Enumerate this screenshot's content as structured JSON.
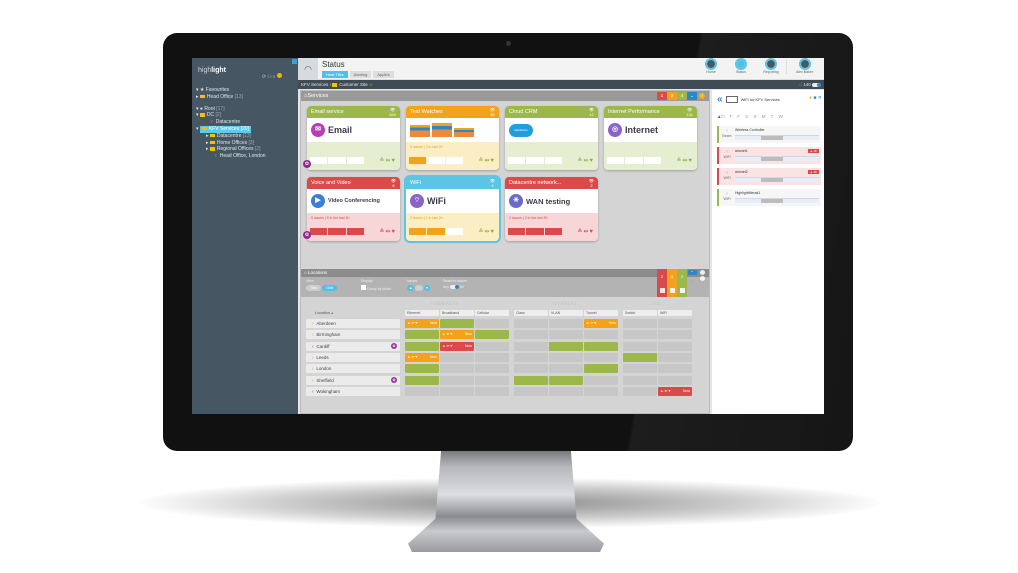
{
  "app": {
    "logo": "highlight",
    "logo_bold": "light",
    "logo_prefix": "high"
  },
  "sidebar": {
    "tree": [
      {
        "label": "Favourites",
        "count": ""
      },
      {
        "label": "Head Office",
        "count": "[13]"
      },
      {
        "label": "Root",
        "count": "[17]"
      },
      {
        "label": "DC",
        "count": "[2]"
      },
      {
        "label": "Datacentre",
        "count": ""
      },
      {
        "label": "KFV Services",
        "count": "[20]"
      },
      {
        "label": "Datacentre",
        "count": "[13]"
      },
      {
        "label": "Home Offices",
        "count": "[3]"
      },
      {
        "label": "Regional Offices",
        "count": "[2]"
      },
      {
        "label": "Head Office, London",
        "count": ""
      }
    ]
  },
  "topbar": {
    "title": "Status",
    "tabs": [
      "Heat Tiles",
      "Alerting",
      "Applt/s"
    ],
    "nav": [
      {
        "label": "Home"
      },
      {
        "label": "Status"
      },
      {
        "label": "Reporting"
      },
      {
        "label": "Alex Baker"
      }
    ]
  },
  "breadcrumb": {
    "root": "KFV Services",
    "sep": "›",
    "current": "Customer Site",
    "refresh": "140"
  },
  "services": {
    "title": "Services",
    "badges": [
      "1",
      "2",
      "4",
      "⌄",
      "?"
    ],
    "tiles": [
      {
        "header": "Email service",
        "count": "624",
        "name": "Email",
        "issues": "",
        "color": "g",
        "icon": "✉"
      },
      {
        "header": "Test Watches",
        "count": "30",
        "name": "",
        "issues": "3 issues | 2 in last 2h",
        "color": "o",
        "icon": ""
      },
      {
        "header": "Cloud CRM",
        "count": "12",
        "name": "salesforce",
        "issues": "",
        "color": "g",
        "icon": ""
      },
      {
        "header": "Internet Performance",
        "count": "131",
        "name": "Internet",
        "issues": "",
        "color": "g",
        "icon": "◎"
      },
      {
        "header": "Voice and Video",
        "count": "6",
        "name": "Video Conferencing",
        "issues": "5 issues | 5 in the last 2h",
        "color": "r",
        "icon": "▶"
      },
      {
        "header": "WiFi",
        "count": "4",
        "name": "WiFi",
        "issues": "2 issues | 1 in last 2h",
        "color": "c",
        "icon": "⌔"
      },
      {
        "header": "Datacentre network...",
        "count": "2",
        "name": "WAN testing",
        "issues": "2 issues | 2 in the last 2h",
        "color": "r",
        "icon": "✳"
      }
    ]
  },
  "locations": {
    "title": "Locations",
    "filters": {
      "view_label": "View",
      "view_tiles": "Tiles",
      "view_grid": "Grid",
      "display_label": "Display",
      "group_by": "Group by folder",
      "issues_label": "Issues",
      "react_label": "React to issues",
      "react_any": "Any",
      "react_all": "All"
    },
    "badge_counts": [
      "2",
      "3",
      "2"
    ],
    "groups": [
      "UNDERLAY",
      "OVERLAY",
      "LAN"
    ],
    "columns": [
      "Ethernet",
      "Broadband",
      "Cellular",
      "Class",
      "VLAN",
      "Tunnel",
      "Switch",
      "WiFi"
    ],
    "location_header": "Location",
    "rows": [
      {
        "name": "Aberdeen",
        "pin": "#f2a31b",
        "gear": false,
        "cells": [
          "O",
          "G",
          "",
          "",
          "",
          "O",
          "",
          ""
        ]
      },
      {
        "name": "Birmingham",
        "pin": "#f2a31b",
        "gear": false,
        "cells": [
          "G",
          "O",
          "G",
          "",
          "",
          "",
          "",
          ""
        ]
      },
      {
        "name": "Cardiff",
        "pin": "#d94b4b",
        "gear": true,
        "cells": [
          "G",
          "R",
          "",
          "",
          "G",
          "G",
          "",
          ""
        ]
      },
      {
        "name": "Leeds",
        "pin": "#f2a31b",
        "gear": false,
        "cells": [
          "O",
          "",
          "",
          "",
          "",
          "",
          "G",
          ""
        ]
      },
      {
        "name": "London",
        "pin": "#9cb84a",
        "gear": false,
        "cells": [
          "G",
          "",
          "",
          "",
          "",
          "G",
          "",
          ""
        ]
      },
      {
        "name": "Sheffield",
        "pin": "#9cb84a",
        "gear": true,
        "cells": [
          "G",
          "",
          "",
          "G",
          "G",
          "",
          "",
          ""
        ]
      },
      {
        "name": "Wokingham",
        "pin": "#d94b4b",
        "gear": false,
        "cells": [
          "",
          "",
          "",
          "",
          "",
          "",
          "",
          "R"
        ]
      }
    ],
    "now_label": "Now"
  },
  "side_panel": {
    "title": "WiFi for KFV Services",
    "days": "T F S S M T W",
    "devices": [
      {
        "name": "Wireless Controller",
        "type": "Beam",
        "alert": false
      },
      {
        "name": "aironet1",
        "type": "WiFi",
        "alert": true
      },
      {
        "name": "aironet2",
        "type": "WiFi",
        "alert": true
      },
      {
        "name": "HighlightMerak1",
        "type": "WiFi",
        "alert": false
      }
    ],
    "alert_label": "2h"
  }
}
